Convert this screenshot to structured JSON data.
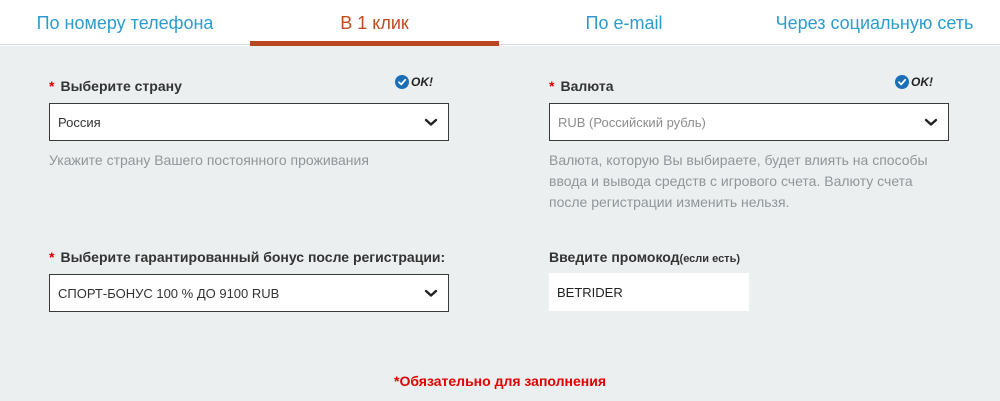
{
  "tabs": [
    {
      "label": "По номеру телефона",
      "active": false
    },
    {
      "label": "В 1 клик",
      "active": true
    },
    {
      "label": "По e-mail",
      "active": false
    },
    {
      "label": "Через социальную сеть",
      "active": false
    }
  ],
  "form": {
    "required_mark": "*",
    "ok_label": "OK!",
    "country": {
      "label": "Выберите страну",
      "value": "Россия",
      "hint": "Укажите страну Вашего постоянного проживания",
      "icon": "chevron-down-icon"
    },
    "currency": {
      "label": "Валюта",
      "value": "RUB (Российский рубль)",
      "hint_lines": [
        "Валюта, которую Вы выбираете, будет влиять на способы",
        "ввода и вывода средств с игрового счета. Валюту счета",
        "после регистрации изменить нельзя."
      ],
      "icon": "chevron-down-icon"
    },
    "bonus": {
      "label": "Выберите гарантированный бонус после регистрации:",
      "value": "СПОРТ-БОНУС 100 % ДО 9100 RUB",
      "icon": "chevron-down-icon"
    },
    "promo": {
      "label": "Введите промокод",
      "label_note": "(если есть)",
      "value": "BETRIDER"
    },
    "required_note": "*Обязательно для заполнения"
  },
  "colors": {
    "accent_active": "#c24a1f",
    "tab_link": "#2c9ccf",
    "required": "#e30000",
    "ok_icon": "#1c6fb7",
    "background": "#eceff0"
  }
}
